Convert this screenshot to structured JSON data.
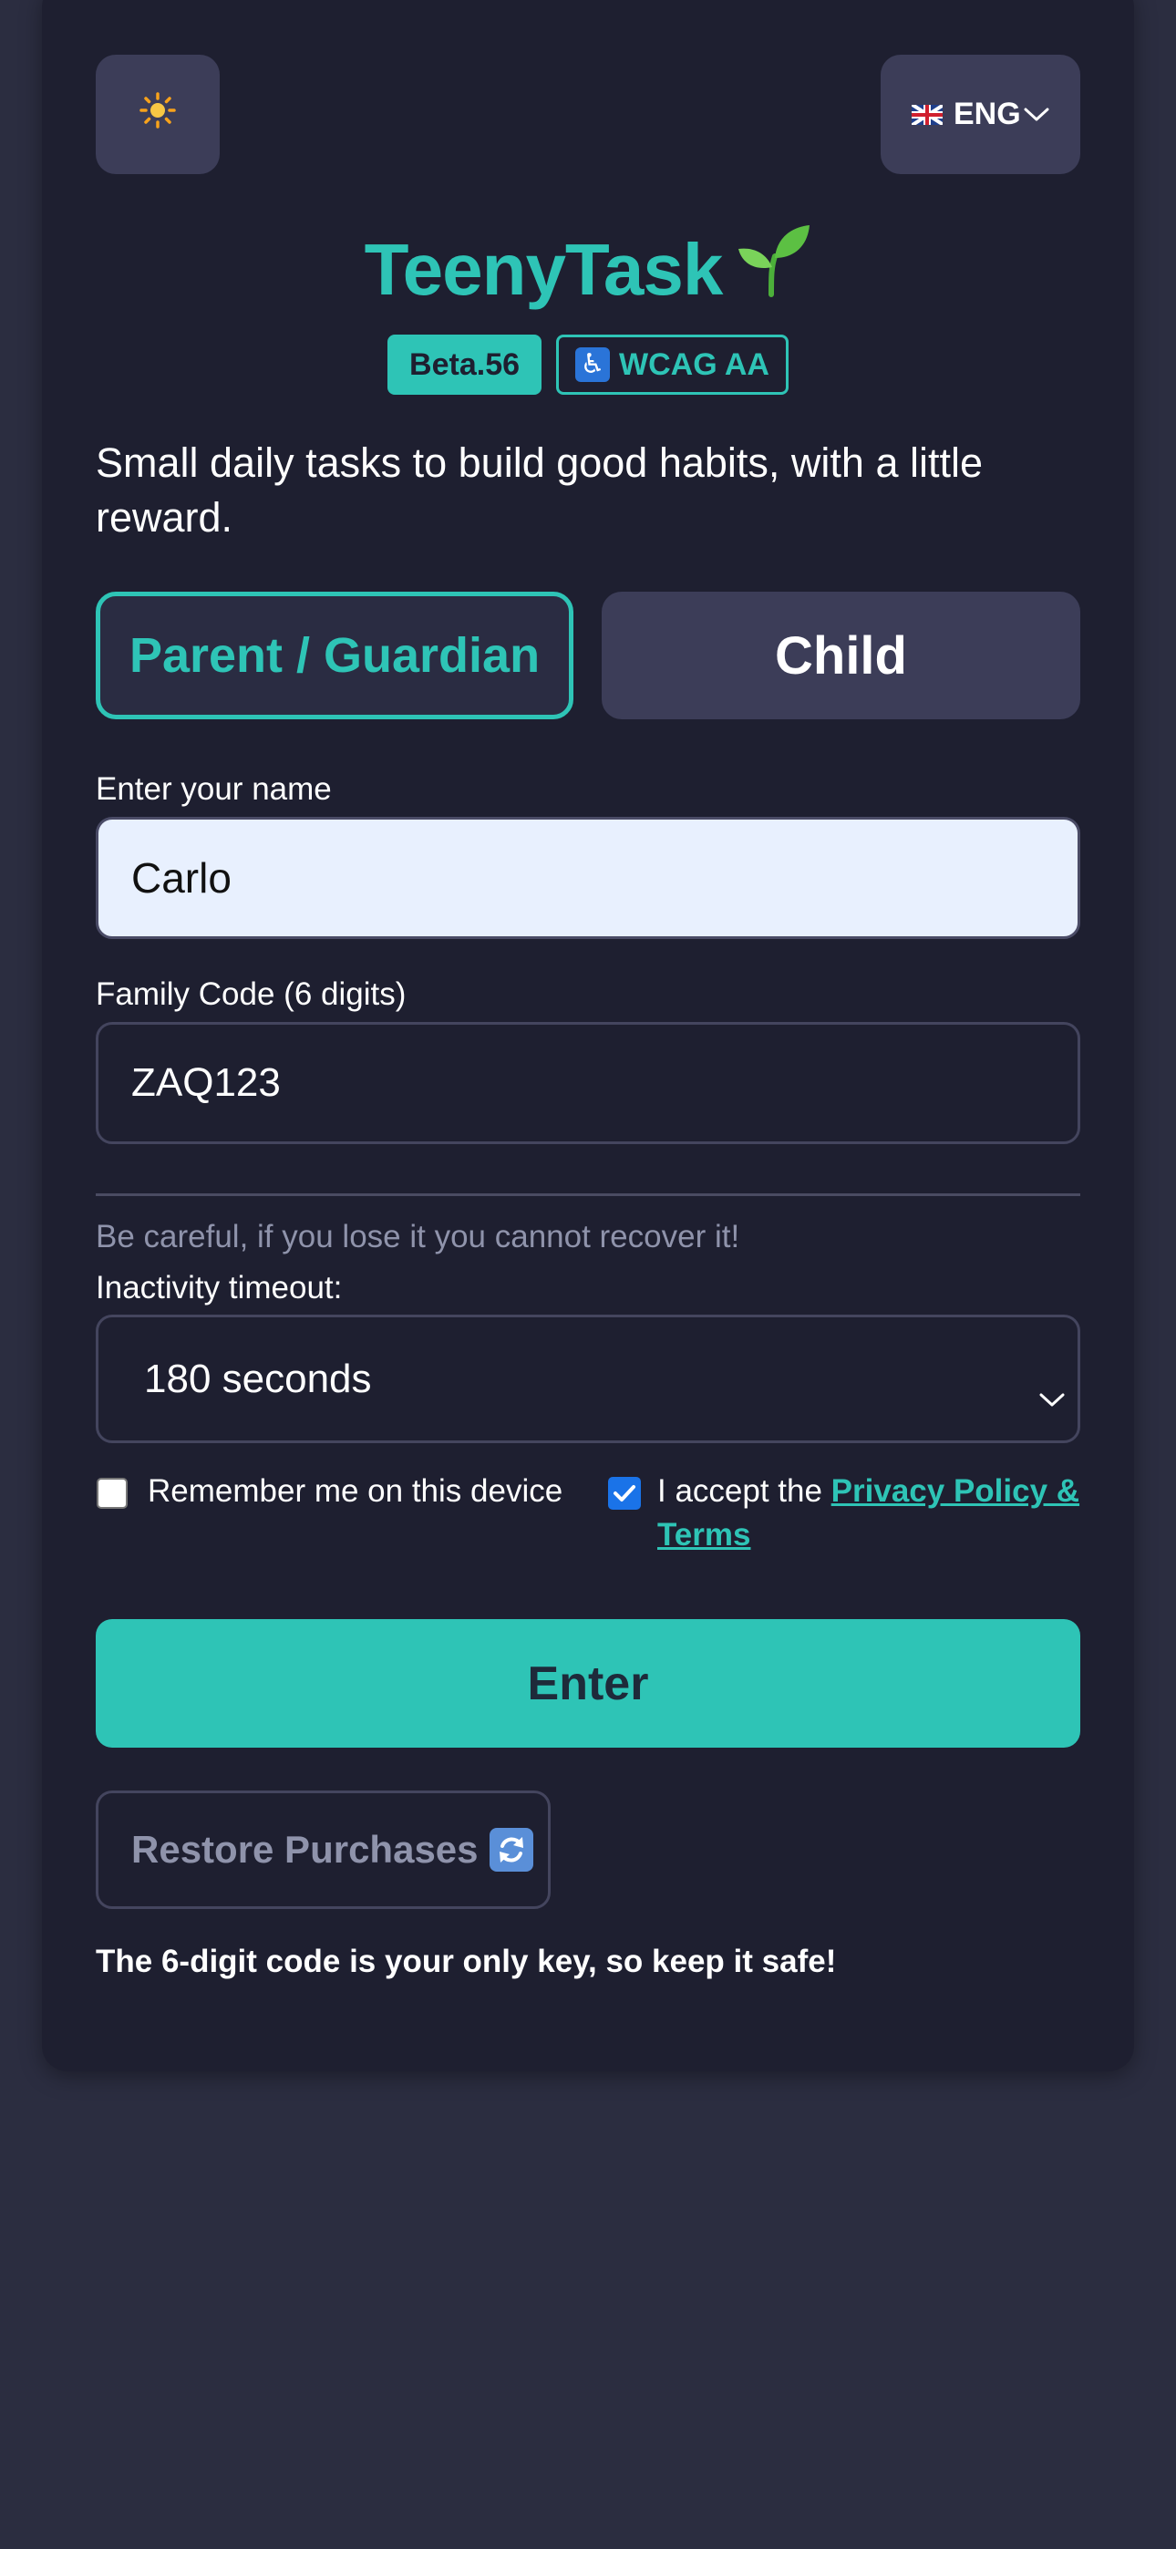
{
  "header": {
    "theme_icon": "sun-icon",
    "language": {
      "flag_icon": "uk-flag-icon",
      "label": "ENG",
      "chevron_icon": "chevron-down-icon"
    }
  },
  "brand": {
    "title": "TeenyTask",
    "logo_icon": "sprout-icon",
    "version_badge": "Beta.56",
    "a11y_badge": "WCAG AA",
    "a11y_icon": "wheelchair-icon",
    "tagline": "Small daily tasks to build good habits, with a little reward."
  },
  "roles": {
    "parent_label": "Parent / Guardian",
    "child_label": "Child",
    "selected": "Parent / Guardian"
  },
  "form": {
    "name_label": "Enter your name",
    "name_value": "Carlo",
    "code_label": "Family Code (6 digits)",
    "code_value": "ZAQ123",
    "warning": "Be careful, if you lose it you cannot recover it!",
    "timeout_label": "Inactivity timeout:",
    "timeout_value": "180 seconds",
    "remember_label": "Remember me on this device",
    "remember_checked": false,
    "accept_prefix": "I accept the ",
    "accept_link": "Privacy Policy & Terms",
    "accept_checked": true
  },
  "actions": {
    "enter_label": "Enter",
    "restore_label": "Restore Purchases",
    "restore_icon": "refresh-icon"
  },
  "footer_note": "The 6-digit code is your only key, so keep it safe!",
  "colors": {
    "accent": "#2ec4b6",
    "background": "#2b2d40",
    "card": "#1e1f30",
    "button_secondary": "#3c3d58",
    "input_autofill": "#e8f0fe",
    "checkbox_checked": "#1a73e8"
  }
}
